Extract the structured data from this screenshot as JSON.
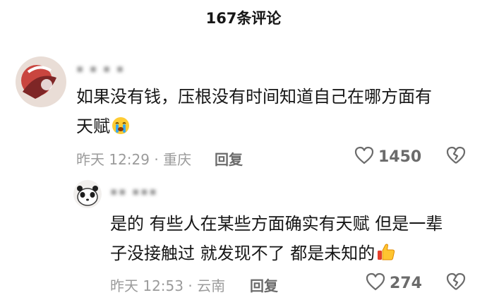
{
  "header": {
    "title": "167条评论"
  },
  "comments": [
    {
      "username": "▪ ▪ ▪ ▪",
      "text_line1": "如果没有钱，压根没有时间知道自己在哪方面有",
      "text_line2": "天赋",
      "emoji": "crying-face-icon",
      "meta": "昨天 12:29 · 重庆",
      "reply_label": "回复",
      "like_count": "1450"
    },
    {
      "username": "▪▪ ▪▪▪",
      "text_line1": "是的 有些人在某些方面确实有天赋 但是一辈",
      "text_line2": "子没接触过 就发现不了 都是未知的",
      "emoji": "thumbs-up-icon",
      "meta": "昨天 12:53 · 云南",
      "reply_label": "回复",
      "like_count": "274"
    }
  ]
}
